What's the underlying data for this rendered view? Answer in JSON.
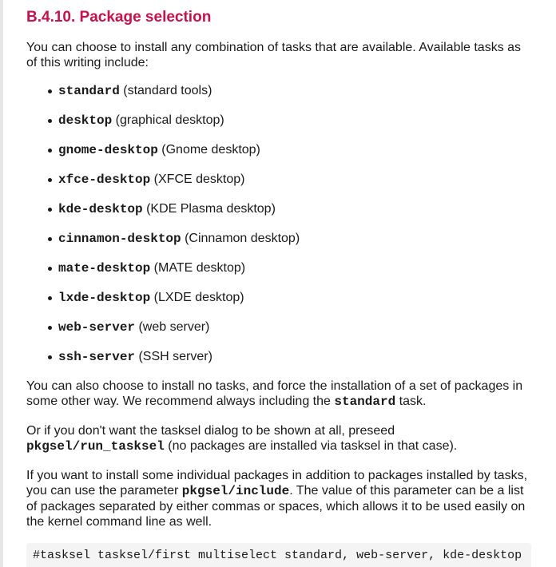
{
  "section": {
    "title": "B.4.10. Package selection"
  },
  "intro": "You can choose to install any combination of tasks that are available. Available tasks as of this writing include:",
  "tasks": [
    {
      "name": "standard",
      "desc": " (standard tools)"
    },
    {
      "name": "desktop",
      "desc": " (graphical desktop)"
    },
    {
      "name": "gnome-desktop",
      "desc": " (Gnome desktop)"
    },
    {
      "name": "xfce-desktop",
      "desc": " (XFCE desktop)"
    },
    {
      "name": "kde-desktop",
      "desc": " (KDE Plasma desktop)"
    },
    {
      "name": "cinnamon-desktop",
      "desc": " (Cinnamon desktop)"
    },
    {
      "name": "mate-desktop",
      "desc": " (MATE desktop)"
    },
    {
      "name": "lxde-desktop",
      "desc": " (LXDE desktop)"
    },
    {
      "name": "web-server",
      "desc": " (web server)"
    },
    {
      "name": "ssh-server",
      "desc": " (SSH server)"
    }
  ],
  "para_no_tasks": {
    "before": "You can also choose to install no tasks, and force the installation of a set of packages in some other way. We recommend always including the ",
    "code": "standard",
    "after": " task."
  },
  "para_preseed": {
    "before": "Or if you don't want the tasksel dialog to be shown at all, preseed ",
    "code": "pkgsel/run_tasksel",
    "after": " (no packages are installed via tasksel in that case)."
  },
  "para_include": {
    "before": "If you want to install some individual packages in addition to packages installed by tasks, you can use the parameter ",
    "code": "pkgsel/include",
    "after": ". The value of this parameter can be a list of packages separated by either commas or spaces, which allows it to be used easily on the kernel command line as well."
  },
  "code_block": "#tasksel tasksel/first multiselect standard, web-server, kde-desktop"
}
